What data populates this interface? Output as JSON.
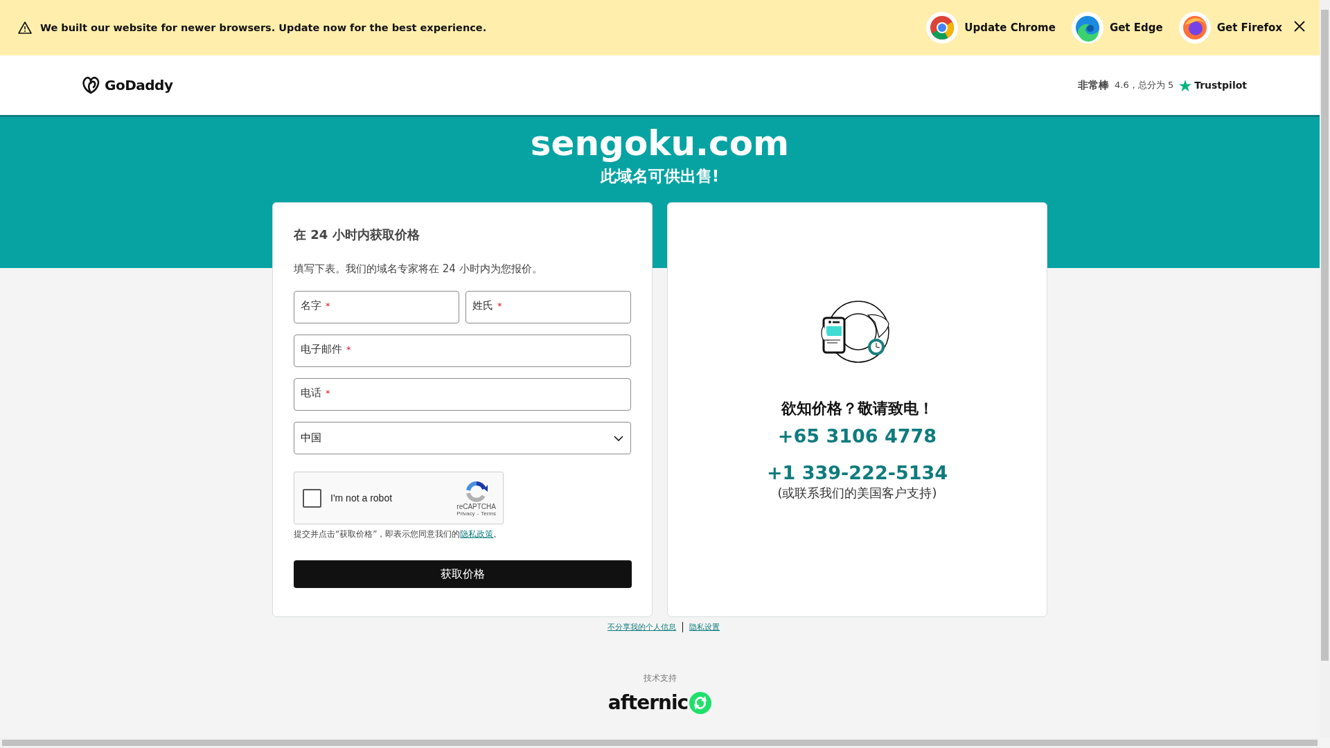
{
  "banner": {
    "message": "We built our website for newer browsers. Update now for the best experience.",
    "browsers": [
      {
        "kind": "chrome",
        "label": "Update Chrome"
      },
      {
        "kind": "edge",
        "label": "Get Edge"
      },
      {
        "kind": "firefox",
        "label": "Get Firefox"
      }
    ]
  },
  "header": {
    "logo": "GoDaddy",
    "rating": {
      "word": "非常棒",
      "score": "4.6，总分为 5",
      "brand": "Trustpilot"
    }
  },
  "hero": {
    "domain": "sengoku.com",
    "subtitle": "此域名可供出售!"
  },
  "form": {
    "title": "在 24 小时内获取价格",
    "intro": "填写下表。我们的域名专家将在 24 小时内为您报价。",
    "fields": [
      {
        "kind": "text",
        "label": "名字",
        "required_mark": "*"
      },
      {
        "kind": "text",
        "label": "姓氏",
        "required_mark": "*"
      },
      {
        "kind": "text",
        "label": "电子邮件",
        "required_mark": "*"
      },
      {
        "kind": "text",
        "label": "电话",
        "required_mark": "*"
      },
      {
        "kind": "select",
        "value": "中国"
      }
    ],
    "captcha": {
      "checked": false,
      "label": "I'm not a robot",
      "brand": "reCAPTCHA",
      "privacy": "Privacy",
      "separator": "-",
      "terms": "Terms"
    },
    "consent": {
      "text": "提交并点击“获取价格”，即表示您同意我们的",
      "link": "隐私政策",
      "end": "。"
    },
    "submit": "获取价格"
  },
  "call": {
    "heading": "欲知价格？敬请致电！",
    "phones": [
      "+65 3106 4778",
      "+1 339-222-5134"
    ],
    "note": "(或联系我们的美国客户支持)"
  },
  "footer_links": [
    "不分享我的个人信息",
    "隐私设置"
  ],
  "powered_by": {
    "label": "技术支持",
    "logo": "afternic"
  }
}
